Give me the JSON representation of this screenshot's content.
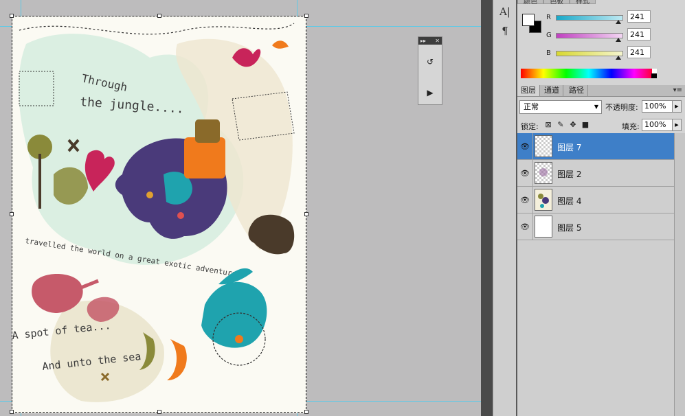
{
  "color_panel": {
    "tabs": [
      "颜色",
      "色板",
      "样式"
    ],
    "sliders": [
      {
        "label": "R",
        "value": "241",
        "level": 0.945,
        "color": "#5fb8cf"
      },
      {
        "label": "G",
        "value": "241",
        "level": 0.945,
        "color": "#c070c0"
      },
      {
        "label": "B",
        "value": "241",
        "level": 0.945,
        "color": "#d8d860"
      }
    ],
    "foreground_color": "#ffffff",
    "background_color": "#000000"
  },
  "layers_panel": {
    "tabs": [
      "图层",
      "通道",
      "路径"
    ],
    "active_tab": "图层",
    "blend_mode": "正常",
    "opacity_label": "不透明度:",
    "opacity_value": "100%",
    "lock_label": "锁定:",
    "fill_label": "填充:",
    "fill_value": "100%",
    "layers": [
      {
        "name": "图层 7",
        "selected": true,
        "thumbnail": "transparent"
      },
      {
        "name": "图层 2",
        "selected": false,
        "thumbnail": "transparent-art"
      },
      {
        "name": "图层 4",
        "selected": false,
        "thumbnail": "art"
      },
      {
        "name": "图层 5",
        "selected": false,
        "thumbnail": "white"
      }
    ]
  },
  "canvas": {
    "artwork_texts": [
      "Through",
      "the jungle....",
      "travelled the world on a great exotic adventure",
      "A spot of tea...",
      "And unto the sea"
    ],
    "colors": {
      "teal": "#1fa3ae",
      "purple": "#4a3a7a",
      "orange": "#f07a1c",
      "magenta": "#c8245a",
      "olive": "#8a8a3a",
      "brown": "#4a3a2a",
      "pink": "#c65a6a"
    }
  },
  "icons": {
    "toolstrip": [
      "character-icon",
      "paragraph-icon"
    ],
    "mini_panel": [
      "history-icon",
      "actions-play-icon"
    ]
  }
}
